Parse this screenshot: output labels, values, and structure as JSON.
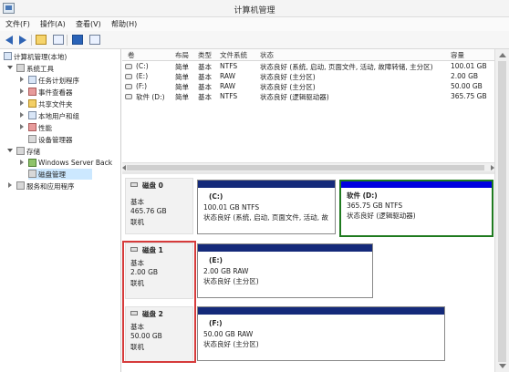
{
  "window": {
    "title": "计算机管理"
  },
  "menu": [
    "文件(F)",
    "操作(A)",
    "查看(V)",
    "帮助(H)"
  ],
  "toolbar": {
    "icons": [
      "back-icon",
      "forward-icon",
      "up-level-icon",
      "show-hide-tree-icon",
      "help-icon",
      "properties-icon"
    ]
  },
  "tree": [
    {
      "label": "计算机管理(本地)",
      "icon": "computer-icon"
    },
    {
      "label": "系统工具",
      "icon": "tools-icon"
    },
    {
      "label": "任务计划程序",
      "icon": "clock-icon"
    },
    {
      "label": "事件查看器",
      "icon": "event-icon"
    },
    {
      "label": "共享文件夹",
      "icon": "folder-icon"
    },
    {
      "label": "本地用户和组",
      "icon": "users-icon"
    },
    {
      "label": "性能",
      "icon": "performance-icon"
    },
    {
      "label": "设备管理器",
      "icon": "device-icon"
    },
    {
      "label": "存储",
      "icon": "storage-icon"
    },
    {
      "label": "Windows Server Back",
      "icon": "backup-icon"
    },
    {
      "label": "磁盘管理",
      "icon": "disk-management-icon"
    },
    {
      "label": "服务和应用程序",
      "icon": "services-icon"
    }
  ],
  "table": {
    "headers": [
      "卷",
      "布局",
      "类型",
      "文件系统",
      "状态",
      "容量"
    ],
    "rows": [
      {
        "volume": "(C:)",
        "layout": "简单",
        "type": "基本",
        "fs": "NTFS",
        "status": "状态良好 (系统, 启动, 页面文件, 活动, 故障转储, 主分区)",
        "capacity": "100.01 GB"
      },
      {
        "volume": "(E:)",
        "layout": "简单",
        "type": "基本",
        "fs": "RAW",
        "status": "状态良好 (主分区)",
        "capacity": "2.00 GB"
      },
      {
        "volume": "(F:)",
        "layout": "简单",
        "type": "基本",
        "fs": "RAW",
        "status": "状态良好 (主分区)",
        "capacity": "50.00 GB"
      },
      {
        "volume": "软件 (D:)",
        "layout": "简单",
        "type": "基本",
        "fs": "NTFS",
        "status": "状态良好 (逻辑驱动器)",
        "capacity": "365.75 GB"
      }
    ]
  },
  "disks": [
    {
      "title": "磁盘 0",
      "type": "基本",
      "size": "465.76 GB",
      "state": "联机",
      "partitions": [
        {
          "name": "(C:)",
          "size_fs": "100.01 GB NTFS",
          "status": "状态良好 (系统, 启动, 页面文件, 活动, 故"
        }
      ],
      "logical": {
        "name": "软件  (D:)",
        "size_fs": "365.75 GB NTFS",
        "status": "状态良好 (逻辑驱动器)"
      }
    },
    {
      "title": "磁盘 1",
      "type": "基本",
      "size": "2.00 GB",
      "state": "联机",
      "partitions": [
        {
          "name": "(E:)",
          "size_fs": "2.00 GB RAW",
          "status": "状态良好 (主分区)"
        }
      ]
    },
    {
      "title": "磁盘 2",
      "type": "基本",
      "size": "50.00 GB",
      "state": "联机",
      "partitions": [
        {
          "name": "(F:)",
          "size_fs": "50.00 GB RAW",
          "status": "状态良好 (主分区)"
        }
      ]
    }
  ],
  "colors": {
    "primary_bar": "#142a7a",
    "logical_bar": "#0000e0",
    "logical_border": "#1f7a1f",
    "highlight_box": "#d63b3b",
    "selected": "#cce8ff"
  }
}
